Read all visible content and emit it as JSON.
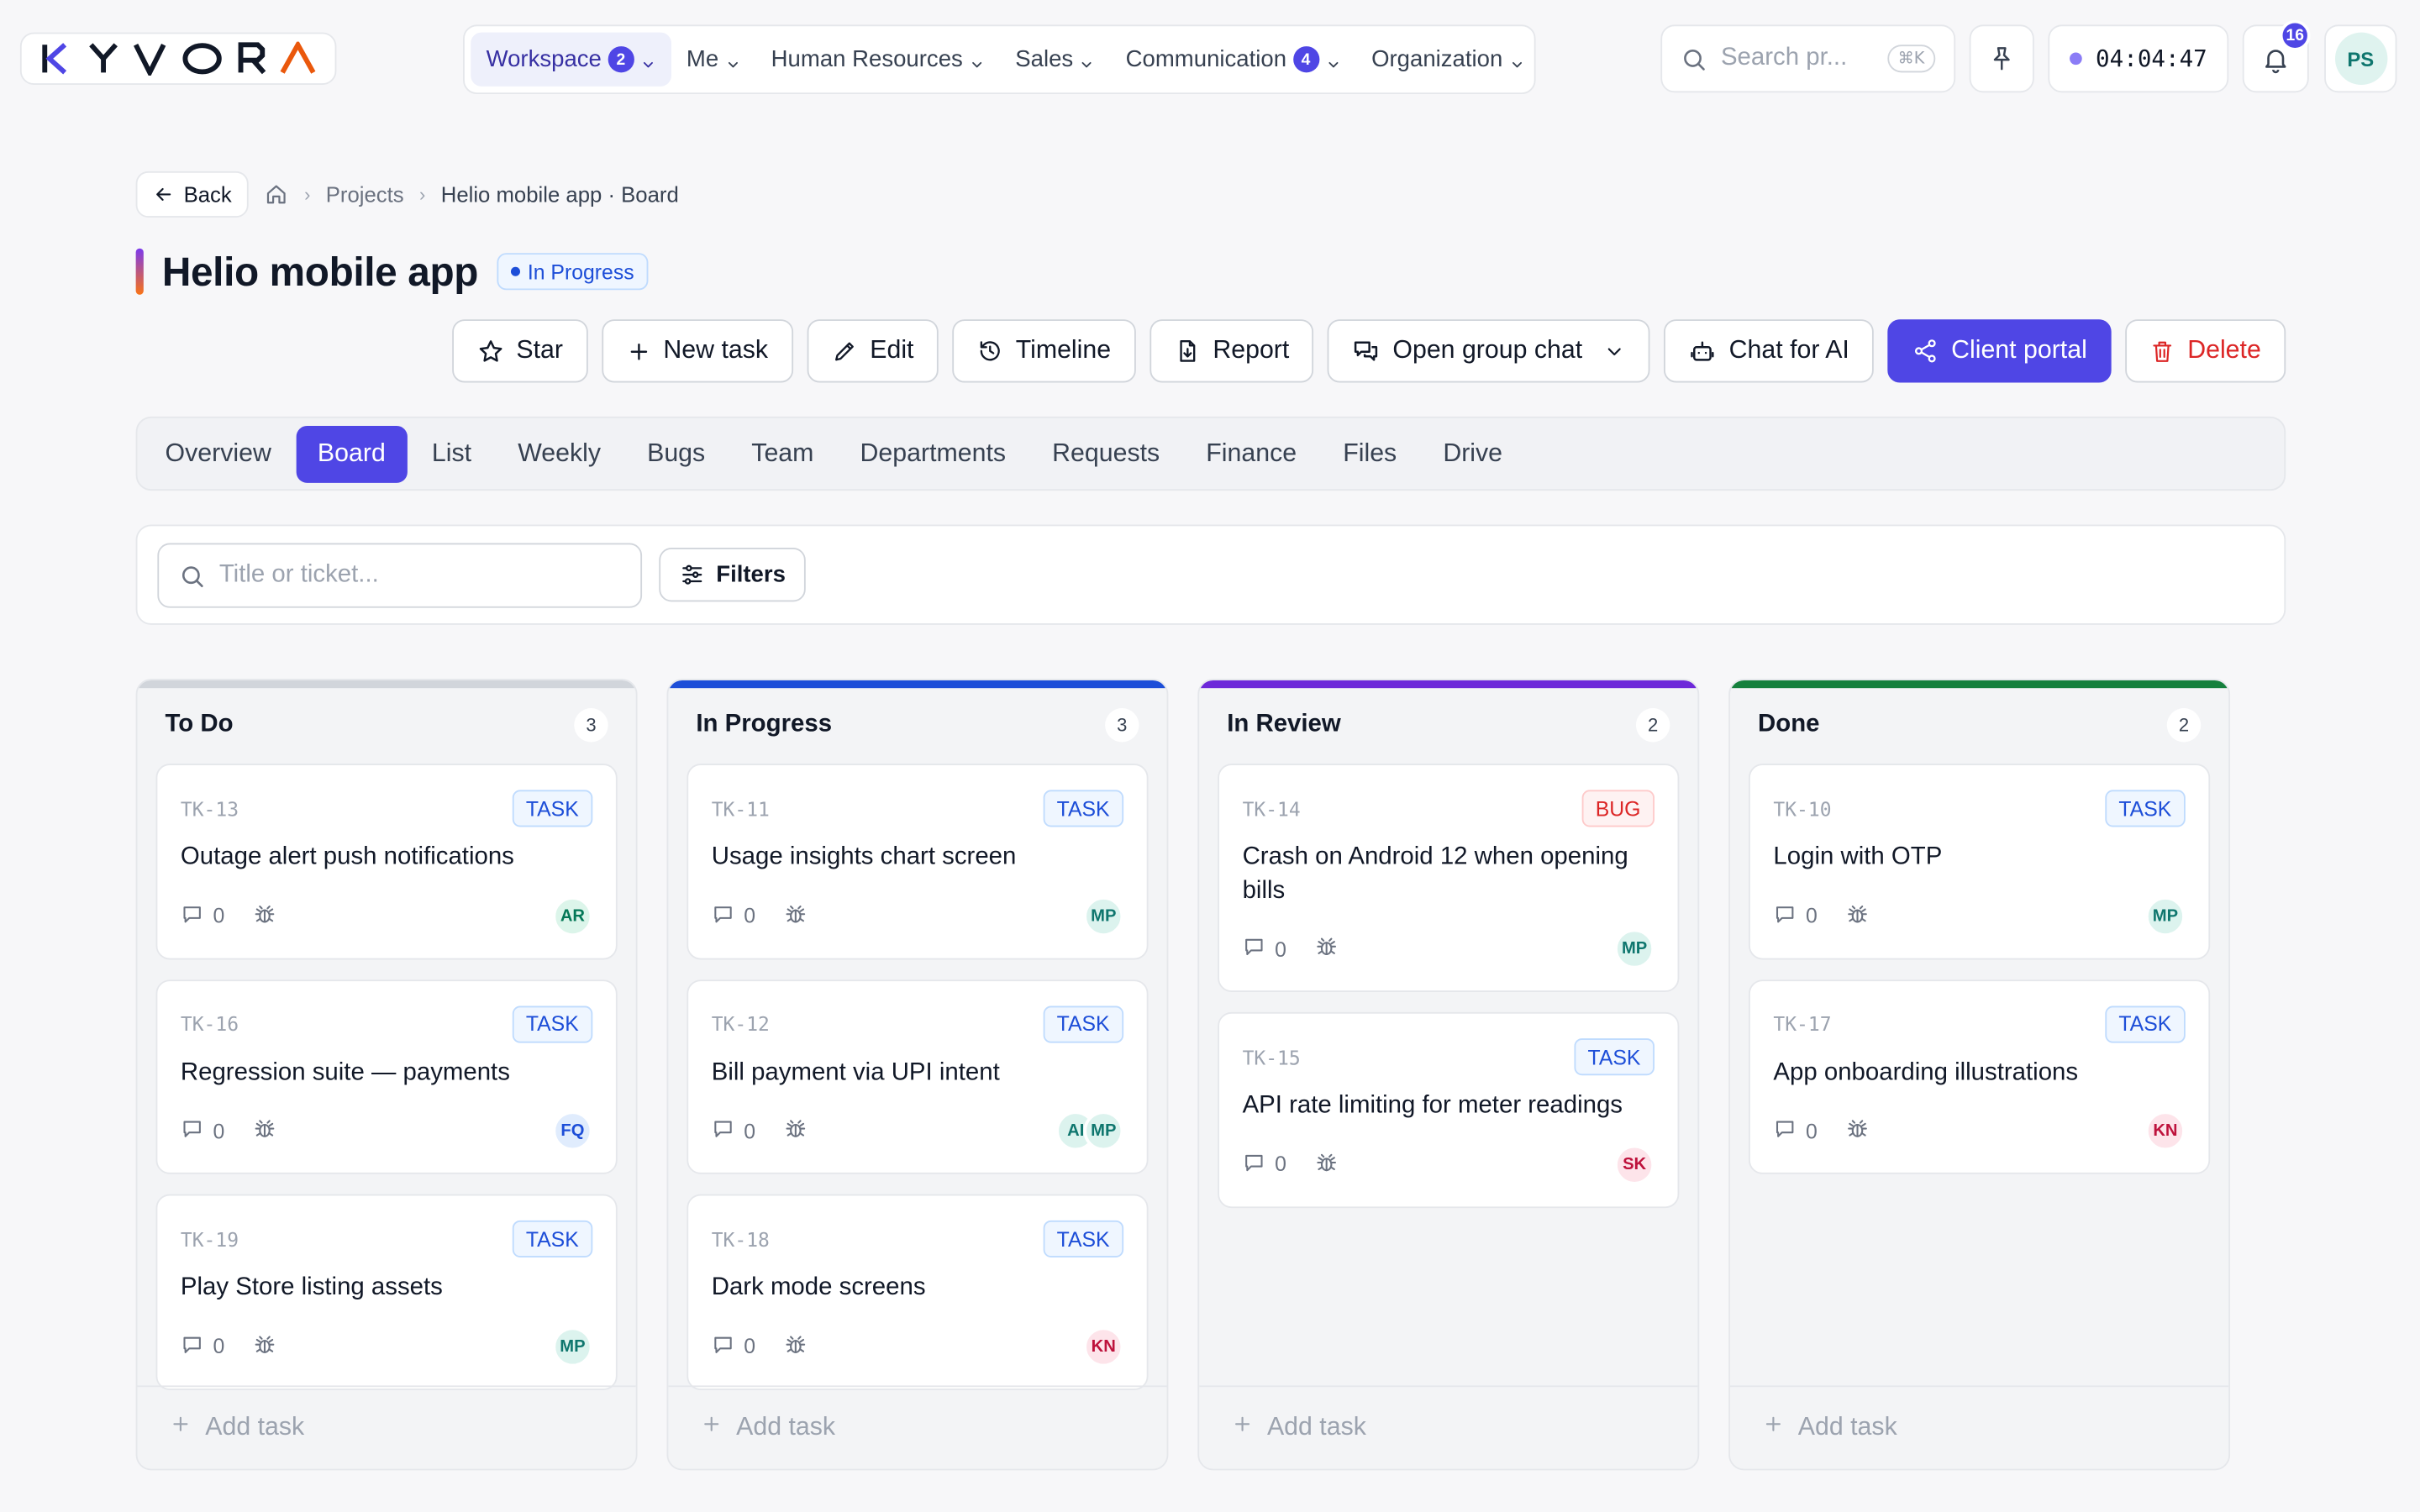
{
  "brand": {
    "logo_text": "KYVORA"
  },
  "nav": {
    "items": [
      {
        "label": "Workspace",
        "badge": "2",
        "active": true
      },
      {
        "label": "Me",
        "badge": ""
      },
      {
        "label": "Human Resources",
        "badge": ""
      },
      {
        "label": "Sales",
        "badge": ""
      },
      {
        "label": "Communication",
        "badge": "4"
      },
      {
        "label": "Organization",
        "badge": ""
      }
    ]
  },
  "topbar": {
    "search_placeholder": "Search pr...",
    "search_shortcut": "⌘K",
    "timer": "04:04:47",
    "notification_count": "16",
    "user_initials": "PS"
  },
  "breadcrumb": {
    "back_label": "Back",
    "projects": "Projects",
    "current": "Helio mobile app · Board"
  },
  "project": {
    "title": "Helio mobile app",
    "status": "In Progress"
  },
  "actions": {
    "star": "Star",
    "new_task": "New task",
    "edit": "Edit",
    "timeline": "Timeline",
    "report": "Report",
    "group_chat": "Open group chat",
    "chat_ai": "Chat for AI",
    "client_portal": "Client portal",
    "delete": "Delete"
  },
  "tabs": [
    "Overview",
    "Board",
    "List",
    "Weekly",
    "Bugs",
    "Team",
    "Departments",
    "Requests",
    "Finance",
    "Files",
    "Drive"
  ],
  "active_tab": "Board",
  "filter": {
    "search_placeholder": "Title or ticket...",
    "filters_label": "Filters"
  },
  "colors": {
    "accent": "#4f46e5",
    "todo": "#d1d5db",
    "in_progress": "#1d4ed8",
    "in_review": "#6d28d9",
    "done": "#15803d"
  },
  "board": {
    "add_task_label": "Add task",
    "columns": [
      {
        "title": "To Do",
        "count": "3",
        "color": "#d1d5db",
        "cards": [
          {
            "id": "TK-13",
            "type": "TASK",
            "title": "Outage alert push notifications",
            "comments": "0",
            "assignees": [
              "AR"
            ]
          },
          {
            "id": "TK-16",
            "type": "TASK",
            "title": "Regression suite — payments",
            "comments": "0",
            "assignees": [
              "FQ"
            ]
          },
          {
            "id": "TK-19",
            "type": "TASK",
            "title": "Play Store listing assets",
            "comments": "0",
            "assignees": [
              "MP"
            ]
          }
        ]
      },
      {
        "title": "In Progress",
        "count": "3",
        "color": "#1d4ed8",
        "cards": [
          {
            "id": "TK-11",
            "type": "TASK",
            "title": "Usage insights chart screen",
            "comments": "0",
            "assignees": [
              "MP"
            ]
          },
          {
            "id": "TK-12",
            "type": "TASK",
            "title": "Bill payment via UPI intent",
            "comments": "0",
            "assignees": [
              "AI",
              "MP"
            ]
          },
          {
            "id": "TK-18",
            "type": "TASK",
            "title": "Dark mode screens",
            "comments": "0",
            "assignees": [
              "KN"
            ]
          }
        ]
      },
      {
        "title": "In Review",
        "count": "2",
        "color": "#6d28d9",
        "cards": [
          {
            "id": "TK-14",
            "type": "BUG",
            "title": "Crash on Android 12 when opening bills",
            "comments": "0",
            "assignees": [
              "MP"
            ]
          },
          {
            "id": "TK-15",
            "type": "TASK",
            "title": "API rate limiting for meter readings",
            "comments": "0",
            "assignees": [
              "SK"
            ]
          }
        ]
      },
      {
        "title": "Done",
        "count": "2",
        "color": "#15803d",
        "cards": [
          {
            "id": "TK-10",
            "type": "TASK",
            "title": "Login with OTP",
            "comments": "0",
            "assignees": [
              "MP"
            ]
          },
          {
            "id": "TK-17",
            "type": "TASK",
            "title": "App onboarding illustrations",
            "comments": "0",
            "assignees": [
              "KN"
            ]
          }
        ]
      }
    ]
  },
  "avatar_colors": {
    "AR": {
      "bg": "#dcf5ea",
      "fg": "#047857"
    },
    "FQ": {
      "bg": "#e0ecfd",
      "fg": "#1d4ed8"
    },
    "MP": {
      "bg": "#dcf3ee",
      "fg": "#0f766e"
    },
    "AI": {
      "bg": "#dcf3ee",
      "fg": "#0f766e"
    },
    "KN": {
      "bg": "#fde4ea",
      "fg": "#be123c"
    },
    "SK": {
      "bg": "#fde4ea",
      "fg": "#be123c"
    }
  }
}
